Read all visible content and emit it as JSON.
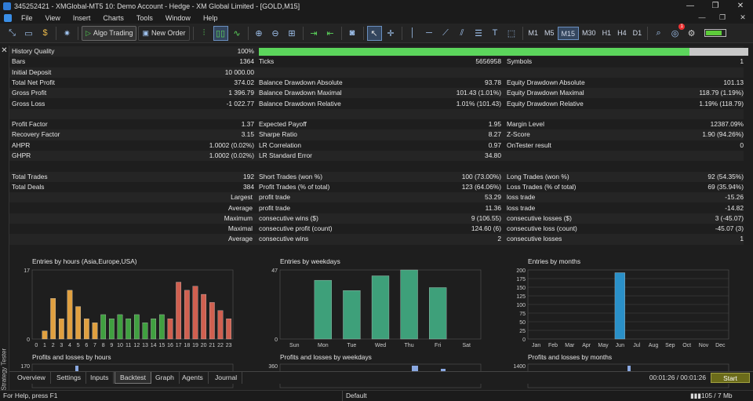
{
  "window": {
    "title": "345252421 - XMGlobal-MT5 10: Demo Account - Hedge - XM Global Limited - [GOLD,M15]",
    "controls": [
      "—",
      "❐",
      "✕"
    ]
  },
  "menu": {
    "items": [
      "File",
      "View",
      "Insert",
      "Charts",
      "Tools",
      "Window",
      "Help"
    ],
    "right": [
      "—",
      "❐",
      "✕"
    ]
  },
  "toolbar": {
    "algo_label": "Algo Trading",
    "neworder_label": "New Order",
    "timeframes": [
      "M1",
      "M5",
      "M15",
      "M30",
      "H1",
      "H4",
      "D1"
    ],
    "active_tf": "M15",
    "alert_count": "1",
    "battery_level": 0.82
  },
  "report": {
    "history_quality_label": "History Quality",
    "history_quality_value": "100%",
    "history_quality_fraction": 0.88,
    "rows": [
      {
        "cells": [
          [
            "Bars",
            "1364"
          ],
          [
            "Ticks",
            "5656958"
          ],
          [
            "Symbols",
            "1"
          ]
        ]
      },
      {
        "cells": [
          [
            "Initial Deposit",
            "10 000.00"
          ],
          [
            "",
            ""
          ],
          [
            "",
            ""
          ]
        ]
      },
      {
        "cells": [
          [
            "Total Net Profit",
            "374.02"
          ],
          [
            "Balance Drawdown Absolute",
            "93.78"
          ],
          [
            "Equity Drawdown Absolute",
            "101.13"
          ]
        ]
      },
      {
        "cells": [
          [
            "Gross Profit",
            "1 396.79"
          ],
          [
            "Balance Drawdown Maximal",
            "101.43 (1.01%)"
          ],
          [
            "Equity Drawdown Maximal",
            "118.79 (1.19%)"
          ]
        ]
      },
      {
        "cells": [
          [
            "Gross Loss",
            "-1 022.77"
          ],
          [
            "Balance Drawdown Relative",
            "1.01% (101.43)"
          ],
          [
            "Equity Drawdown Relative",
            "1.19% (118.79)"
          ]
        ]
      },
      {
        "cells": [
          [
            "",
            ""
          ],
          [
            "",
            ""
          ],
          [
            "",
            ""
          ]
        ]
      },
      {
        "cells": [
          [
            "Profit Factor",
            "1.37"
          ],
          [
            "Expected Payoff",
            "1.95"
          ],
          [
            "Margin Level",
            "12387.09%"
          ]
        ]
      },
      {
        "cells": [
          [
            "Recovery Factor",
            "3.15"
          ],
          [
            "Sharpe Ratio",
            "8.27"
          ],
          [
            "Z-Score",
            "1.90 (94.26%)"
          ]
        ]
      },
      {
        "cells": [
          [
            "AHPR",
            "1.0002 (0.02%)"
          ],
          [
            "LR Correlation",
            "0.97"
          ],
          [
            "OnTester result",
            "0"
          ]
        ]
      },
      {
        "cells": [
          [
            "GHPR",
            "1.0002 (0.02%)"
          ],
          [
            "LR Standard Error",
            "34.80"
          ],
          [
            "",
            ""
          ]
        ]
      },
      {
        "cells": [
          [
            "",
            ""
          ],
          [
            "",
            ""
          ],
          [
            "",
            ""
          ]
        ]
      },
      {
        "cells": [
          [
            "Total Trades",
            "192"
          ],
          [
            "Short Trades (won %)",
            "100 (73.00%)"
          ],
          [
            "Long Trades (won %)",
            "92 (54.35%)"
          ]
        ]
      },
      {
        "cells": [
          [
            "Total Deals",
            "384"
          ],
          [
            "Profit Trades (% of total)",
            "123 (64.06%)"
          ],
          [
            "Loss Trades (% of total)",
            "69 (35.94%)"
          ]
        ]
      }
    ],
    "right_rows": [
      {
        "r": "Largest",
        "cells": [
          [
            "profit trade",
            "53.29"
          ],
          [
            "loss trade",
            "-15.26"
          ]
        ]
      },
      {
        "r": "Average",
        "cells": [
          [
            "profit trade",
            "11.36"
          ],
          [
            "loss trade",
            "-14.82"
          ]
        ]
      },
      {
        "r": "Maximum",
        "cells": [
          [
            "consecutive wins ($)",
            "9 (106.55)"
          ],
          [
            "consecutive losses ($)",
            "3 (-45.07)"
          ]
        ]
      },
      {
        "r": "Maximal",
        "cells": [
          [
            "consecutive profit (count)",
            "124.60 (6)"
          ],
          [
            "consecutive loss (count)",
            "-45.07 (3)"
          ]
        ]
      },
      {
        "r": "Average",
        "cells": [
          [
            "consecutive wins",
            "2"
          ],
          [
            "consecutive losses",
            "1"
          ]
        ]
      }
    ]
  },
  "chart_data": [
    {
      "type": "bar",
      "title": "Entries by hours (Asia,Europe,USA)",
      "categories": [
        "0",
        "1",
        "2",
        "3",
        "4",
        "5",
        "6",
        "7",
        "8",
        "9",
        "10",
        "11",
        "12",
        "13",
        "14",
        "15",
        "16",
        "17",
        "18",
        "19",
        "20",
        "21",
        "22",
        "23"
      ],
      "values": [
        0,
        2,
        10,
        5,
        12,
        8,
        5,
        4,
        6,
        5,
        6,
        5,
        6,
        4,
        5,
        6,
        5,
        14,
        12,
        13,
        11,
        9,
        7,
        5,
        5
      ],
      "ylim": [
        0,
        17
      ],
      "yticks": [
        "17",
        "0"
      ],
      "colors": [
        "#e0a040",
        "#e0a040",
        "#e0a040",
        "#e0a040",
        "#e0a040",
        "#e0a040",
        "#e0a040",
        "#e0a040",
        "#40a040",
        "#40a040",
        "#40a040",
        "#40a040",
        "#40a040",
        "#40a040",
        "#40a040",
        "#40a040",
        "#d06050",
        "#d06050",
        "#d06050",
        "#d06050",
        "#d06050",
        "#d06050",
        "#d06050",
        "#d06050"
      ]
    },
    {
      "type": "bar",
      "title": "Entries by weekdays",
      "categories": [
        "Sun",
        "Mon",
        "Tue",
        "Wed",
        "Thu",
        "Fri",
        "Sat"
      ],
      "values": [
        0,
        40,
        33,
        43,
        47,
        35,
        0
      ],
      "ylim": [
        0,
        47
      ],
      "yticks": [
        "47",
        "0"
      ],
      "colors": [
        "#3ea07a"
      ]
    },
    {
      "type": "bar",
      "title": "Entries by months",
      "categories": [
        "Jan",
        "Feb",
        "Mar",
        "Apr",
        "May",
        "Jun",
        "Jul",
        "Aug",
        "Sep",
        "Oct",
        "Nov",
        "Dec"
      ],
      "values": [
        0,
        0,
        0,
        0,
        0,
        192,
        0,
        0,
        0,
        0,
        0,
        0
      ],
      "ylim": [
        0,
        200
      ],
      "yticks": [
        "200",
        "175",
        "150",
        "125",
        "100",
        "75",
        "50",
        "25",
        "0"
      ],
      "colors": [
        "#2a90c8"
      ]
    }
  ],
  "pl_charts": [
    {
      "title": "Profits and losses by hours",
      "ytick": "170"
    },
    {
      "title": "Profits and losses by weekdays",
      "ytick": "360"
    },
    {
      "title": "Profits and losses by months",
      "ytick": "1400"
    }
  ],
  "tabs": {
    "items": [
      "Overview",
      "Settings",
      "Inputs",
      "Backtest",
      "Graph",
      "Agents",
      "Journal"
    ],
    "active": "Backtest",
    "timer": "00:01:26 / 00:01:26",
    "start_label": "Start"
  },
  "side": {
    "label": "Strategy Tester"
  },
  "status": {
    "help": "For Help, press F1",
    "profile": "Default",
    "traffic": "105 / 7 Mb"
  }
}
